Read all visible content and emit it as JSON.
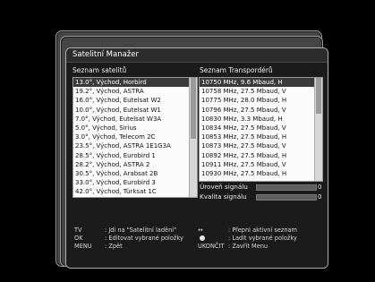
{
  "window": {
    "title": "Satelitní Manažer"
  },
  "satellites": {
    "label": "Seznam satelitů",
    "items": [
      "13.0°, Východ, Horbird",
      "19.2°, Východ, ASTRA",
      "16.0°, Východ, Eutelsat W2",
      "10.0°, Východ, Eutelsat W1",
      "7.0°, Východ, Eutelsat W3A",
      "5.0°, Východ, Sirius",
      "3.0°, Východ, Telecom 2C",
      "23.5°, Východ, ASTRA 1E1G3A",
      "28.5°, Východ, Eurobird 1",
      "28.2°, Východ, ASTRA 2",
      "30.5°, Východ, Arabsat 2B",
      "33.0°, Východ, Eurobird 3",
      "42.0°, Východ, Türksat 1C"
    ],
    "selected_index": 0,
    "scroll_position": 0.0
  },
  "transponders": {
    "label": "Seznam Transpordérů",
    "items": [
      "10750 MHz, 9.6 Mbaud, H",
      "10758 MHz, 27.5 Mbaud, V",
      "10775 MHz, 28.0 Mbaud, H",
      "10796 MHz, 27.5 Mbaud, V",
      "10830 MHz, 3.3 Mbaud, H",
      "10834 MHz, 27.5 Mbaud, V",
      "10853 MHz, 27.5 Mbaud, H",
      "10873 MHz, 27.5 Mbaud, V",
      "10892 MHz, 27.5 Mbaud, H",
      "10911 MHz, 27.5 Mbaud, V",
      "10930 MHz, 27.5 Mbaud, H"
    ],
    "selected_index": 0,
    "scroll_position": 0.0
  },
  "signal": {
    "level_label": "Úroveň signálu",
    "level_value": "0",
    "quality_label": "Kvalita signálu",
    "quality_value": "0"
  },
  "footer": {
    "tv_key": "TV",
    "tv_desc": ": Jdi na \"Satelitní ladění\"",
    "ok_key": "OK",
    "ok_desc": ": Editovat vybrané položky",
    "menu_key": "MENU",
    "menu_desc": ": Zpět",
    "arrows_key": "↔",
    "arrows_desc": ": Přepni aktivní seznam",
    "dot_desc": ": Ladit vybrané položky",
    "exit_key": "UKONČIT",
    "exit_desc": ": Zavřít Menu"
  }
}
